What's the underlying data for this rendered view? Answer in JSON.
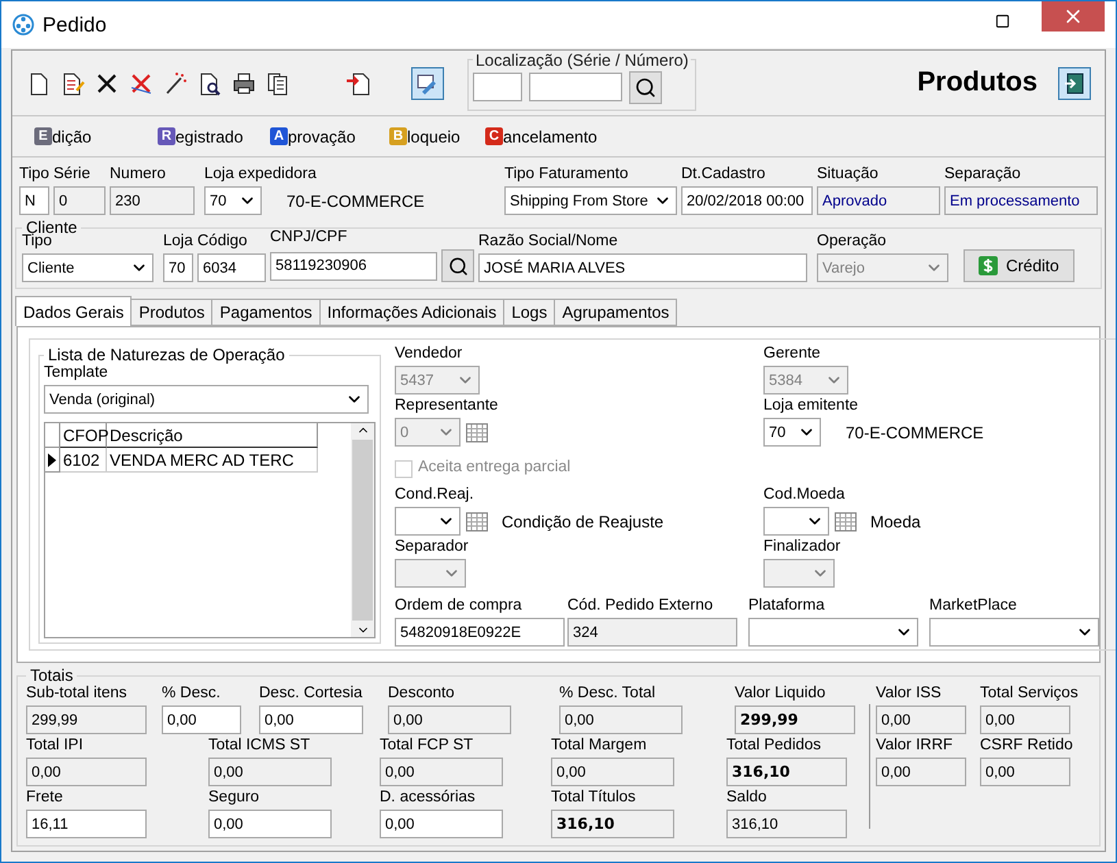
{
  "window": {
    "title": "Pedido"
  },
  "toolbar": {
    "locator_label": "Localização (Série / Número)",
    "section_title": "Produtos"
  },
  "status_steps": [
    {
      "letter": "E",
      "label": "dição",
      "color": "#6c6c7c"
    },
    {
      "letter": "R",
      "label": "egistrado",
      "color": "#6658b8"
    },
    {
      "letter": "A",
      "label": "provação",
      "color": "#1f55d6"
    },
    {
      "letter": "B",
      "label": "loqueio",
      "color": "#d6a020"
    },
    {
      "letter": "C",
      "label": "ancelamento",
      "color": "#d42a1a"
    }
  ],
  "header": {
    "left": [
      {
        "label": "Tipo",
        "value": "N",
        "kind": "input"
      },
      {
        "label": "Série",
        "value": "0",
        "kind": "readonly"
      },
      {
        "label": "Numero",
        "value": "230",
        "kind": "readonly"
      },
      {
        "label": "Loja expedidora",
        "value": "70",
        "kind": "select",
        "disabled": false,
        "caption": "70-E-COMMERCE"
      }
    ],
    "right": [
      {
        "label": "Tipo Faturamento",
        "value": "Shipping From Store",
        "kind": "select",
        "disabled": false
      },
      {
        "label": "Dt.Cadastro",
        "value": "20/02/2018 00:00",
        "kind": "input"
      },
      {
        "label": "Situação",
        "value": "Aprovado",
        "kind": "status"
      },
      {
        "label": "Separação",
        "value": "Em processamento",
        "kind": "status"
      }
    ]
  },
  "cliente": {
    "title": "Cliente",
    "fields": [
      {
        "label": "Tipo",
        "value": "Cliente",
        "kind": "select",
        "disabled": false
      },
      {
        "label": "Loja",
        "value": "70",
        "kind": "input"
      },
      {
        "label": "Código",
        "value": "6034",
        "kind": "input"
      },
      {
        "label": "CNPJ/CPF",
        "value": "58119230906",
        "kind": "search"
      },
      {
        "label": "Razão Social/Nome",
        "value": "JOSÉ MARIA ALVES",
        "kind": "input"
      },
      {
        "label": "Operação",
        "value": "Varejo",
        "kind": "select",
        "disabled": true
      }
    ],
    "credit_button": "Crédito"
  },
  "tabs": [
    {
      "label": "Dados Gerais",
      "selected": true
    },
    {
      "label": "Produtos",
      "selected": false
    },
    {
      "label": "Pagamentos",
      "selected": false
    },
    {
      "label": "Informações Adicionais",
      "selected": false
    },
    {
      "label": "Logs",
      "selected": false
    },
    {
      "label": "Agrupamentos",
      "selected": false
    }
  ],
  "naturezas": {
    "title": "Lista de Naturezas de Operação",
    "template_label": "Template",
    "template_value": "Venda (original)",
    "columns": [
      "CFOP",
      "Descrição"
    ],
    "rows": [
      {
        "cells": [
          "6102",
          "VENDA MERC AD TERC"
        ],
        "selected": true
      }
    ]
  },
  "dados": {
    "rows": [
      [
        {
          "kind": "select",
          "label": "Vendedor",
          "value": "5437",
          "disabled": true
        },
        {
          "kind": "select",
          "label": "Gerente",
          "value": "5384",
          "disabled": true
        }
      ],
      [
        {
          "kind": "lookup",
          "label": "Representante",
          "value": "0",
          "disabled": true
        },
        {
          "kind": "select",
          "label": "Loja emitente",
          "value": "70",
          "disabled": false,
          "caption": "70-E-COMMERCE"
        }
      ],
      [
        {
          "kind": "checkbox",
          "label": "Aceita entrega parcial",
          "checked": false,
          "disabled": true
        }
      ],
      [
        {
          "kind": "lookup",
          "label": "Cond.Reaj.",
          "disabled": false,
          "caption": "Condição de Reajuste"
        },
        {
          "kind": "lookup",
          "label": "Cod.Moeda",
          "disabled": false,
          "caption": "Moeda"
        }
      ],
      [
        {
          "kind": "select",
          "label": "Separador",
          "disabled": true
        },
        {
          "kind": "select",
          "label": "Finalizador",
          "disabled": true
        }
      ]
    ],
    "bottom": [
      {
        "label": "Ordem de compra",
        "value": "54820918E0922E",
        "kind": "input"
      },
      {
        "label": "Cód. Pedido Externo",
        "value": "324",
        "kind": "readonly"
      },
      {
        "label": "Plataforma",
        "kind": "select",
        "disabled": false
      },
      {
        "label": "MarketPlace",
        "kind": "select",
        "disabled": false
      }
    ]
  },
  "totais": {
    "title": "Totais",
    "fields": [
      {
        "label": "Sub-total itens",
        "value": "299,99",
        "kind": "readonly",
        "bold": false
      },
      {
        "label": "% Desc.",
        "value": "0,00",
        "kind": "input",
        "bold": false
      },
      {
        "label": "Desc. Cortesia",
        "value": "0,00",
        "kind": "input",
        "bold": false
      },
      {
        "label": "Desconto",
        "value": "0,00",
        "kind": "readonly",
        "bold": false
      },
      {
        "label": "% Desc. Total",
        "value": "0,00",
        "kind": "readonly",
        "bold": false
      },
      {
        "label": "Valor Liquido",
        "value": "299,99",
        "kind": "readonly",
        "bold": true
      },
      {
        "label": "Total IPI",
        "value": "0,00",
        "kind": "readonly",
        "bold": false
      },
      {
        "label": "Total ICMS ST",
        "value": "0,00",
        "kind": "readonly",
        "bold": false
      },
      {
        "label": "Total FCP ST",
        "value": "0,00",
        "kind": "readonly",
        "bold": false
      },
      {
        "label": "Total Margem",
        "value": "0,00",
        "kind": "readonly",
        "bold": false
      },
      {
        "label": "Total Pedidos",
        "value": "316,10",
        "kind": "readonly",
        "bold": true
      },
      {
        "label": "Frete",
        "value": "16,11",
        "kind": "input",
        "bold": false
      },
      {
        "label": "Seguro",
        "value": "0,00",
        "kind": "input",
        "bold": false
      },
      {
        "label": "D. acessórias",
        "value": "0,00",
        "kind": "input",
        "bold": false
      },
      {
        "label": "Total Títulos",
        "value": "316,10",
        "kind": "readonly",
        "bold": true
      },
      {
        "label": "Saldo",
        "value": "316,10",
        "kind": "readonly",
        "bold": false
      }
    ],
    "side_fields": [
      {
        "label": "Valor ISS",
        "value": "0,00",
        "kind": "readonly",
        "bold": false
      },
      {
        "label": "Total Serviços",
        "value": "0,00",
        "kind": "readonly",
        "bold": false
      },
      {
        "label": "Valor IRRF",
        "value": "0,00",
        "kind": "readonly",
        "bold": false
      },
      {
        "label": "CSRF Retido",
        "value": "0,00",
        "kind": "readonly",
        "bold": false
      }
    ]
  }
}
